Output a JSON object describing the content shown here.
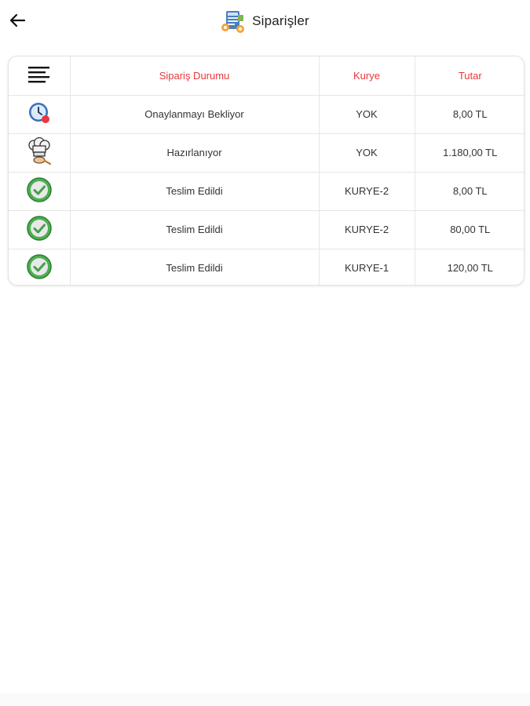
{
  "header": {
    "title": "Siparişler",
    "back_icon": "arrow-left-icon",
    "title_icon": "orders-icon"
  },
  "table": {
    "columns": [
      "",
      "Sipariş Durumu",
      "Kurye",
      "Tutar"
    ],
    "header_color": "#e8383d",
    "rows": [
      {
        "icon": "clock-icon",
        "status": "Onaylanmayı Bekliyor",
        "courier": "YOK",
        "amount": "8,00 TL"
      },
      {
        "icon": "chef-icon",
        "status": "Hazırlanıyor",
        "courier": "YOK",
        "amount": "1.180,00 TL"
      },
      {
        "icon": "check-icon",
        "status": "Teslim Edildi",
        "courier": "KURYE-2",
        "amount": "8,00 TL"
      },
      {
        "icon": "check-icon",
        "status": "Teslim Edildi",
        "courier": "KURYE-2",
        "amount": "80,00 TL"
      },
      {
        "icon": "check-icon",
        "status": "Teslim Edildi",
        "courier": "KURYE-1",
        "amount": "120,00 TL"
      }
    ]
  }
}
